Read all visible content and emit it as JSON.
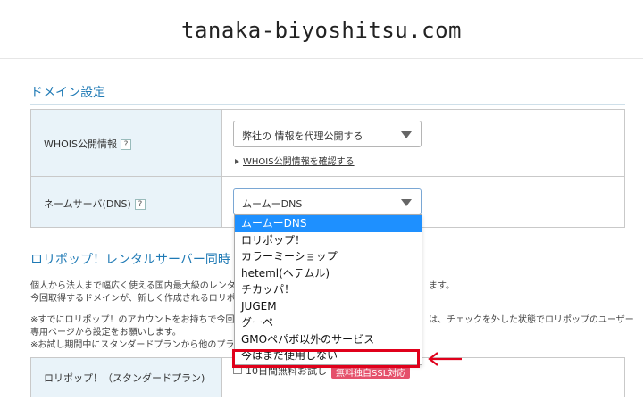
{
  "header": {
    "title": "tanaka-biyoshitsu.com"
  },
  "domain_settings": {
    "section_title": "ドメイン設定",
    "whois": {
      "label": "WHOIS公開情報",
      "help": "?",
      "selected": "弊社の 情報を代理公開する",
      "link": "WHOIS公開情報を確認する"
    },
    "nameserver": {
      "label": "ネームサーバ(DNS)",
      "help": "?",
      "selected": "ムームーDNS",
      "options": [
        "ムームーDNS",
        "ロリポップ！",
        "カラーミーショップ",
        "heteml(ヘテムル)",
        "チカッパ！",
        "JUGEM",
        "グーペ",
        "GMOペパボ以外のサービス",
        "今はまだ使用しない"
      ],
      "highlighted_index": 0,
      "annotated_option": "今はまだ使用しない"
    }
  },
  "lolipop": {
    "heading": "ロリポップ！レンタルサーバー同時",
    "para1_line1": "個人から法人まで幅広く使える国内最大級のレンタル",
    "para1_line1_tail": "ます。",
    "para1_line2": "今回取得するドメインが、新しく作成されるロリポップ",
    "para2_line1": "※すでにロリポップ！のアカウントをお持ちで今回取",
    "para2_line1_tail": "は、チェックを外した状態でロリポップのユーザー",
    "para2_line2": "専用ページから設定をお願いします。",
    "para2_line3": "※お試し期間中にスタンダードプランから他のプラン",
    "plan_label": "ロリポップ！（スタンダードプラン)",
    "trial_label": "10日間無料お試し",
    "ssl_badge": "無料独自SSL対応"
  },
  "colors": {
    "accent": "#1f7ab5",
    "label_bg": "#e9f3f9",
    "selected_option": "#1e90ff",
    "highlight_red": "#e0001b",
    "badge": "#e5506b"
  }
}
